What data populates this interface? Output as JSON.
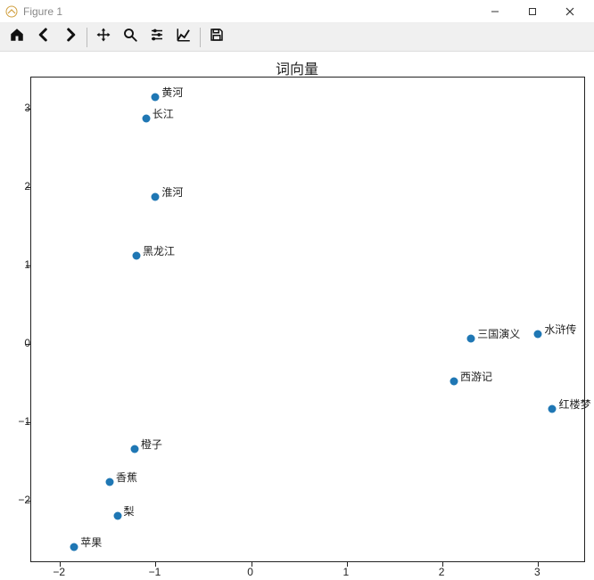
{
  "window": {
    "title": "Figure 1",
    "minimize_tooltip": "Minimize",
    "maximize_tooltip": "Maximize",
    "close_tooltip": "Close"
  },
  "toolbar": {
    "items": [
      {
        "name": "home-icon",
        "label": "Home"
      },
      {
        "name": "back-icon",
        "label": "Back"
      },
      {
        "name": "forward-icon",
        "label": "Forward"
      },
      {
        "sep": true
      },
      {
        "name": "move-icon",
        "label": "Pan"
      },
      {
        "name": "zoom-icon",
        "label": "Zoom"
      },
      {
        "name": "config-icon",
        "label": "Configure subplots"
      },
      {
        "name": "axes-icon",
        "label": "Edit axis"
      },
      {
        "sep": true
      },
      {
        "name": "save-icon",
        "label": "Save"
      }
    ]
  },
  "chart_data": {
    "type": "scatter",
    "title": "词向量",
    "xlabel": "",
    "ylabel": "",
    "xlim": [
      -2.3,
      3.5
    ],
    "ylim": [
      -2.8,
      3.4
    ],
    "xticks": [
      -2,
      -1,
      0,
      1,
      2,
      3
    ],
    "yticks": [
      -2,
      -1,
      0,
      1,
      2,
      3
    ],
    "points": [
      {
        "label": "黄河",
        "x": -1.0,
        "y": 3.15
      },
      {
        "label": "长江",
        "x": -1.1,
        "y": 2.88
      },
      {
        "label": "淮河",
        "x": -1.0,
        "y": 1.88
      },
      {
        "label": "黑龙江",
        "x": -1.2,
        "y": 1.12
      },
      {
        "label": "三国演义",
        "x": 2.3,
        "y": 0.07
      },
      {
        "label": "水浒传",
        "x": 3.0,
        "y": 0.12
      },
      {
        "label": "西游记",
        "x": 2.12,
        "y": -0.48
      },
      {
        "label": "红楼梦",
        "x": 3.15,
        "y": -0.83
      },
      {
        "label": "橙子",
        "x": -1.22,
        "y": -1.34
      },
      {
        "label": "香蕉",
        "x": -1.48,
        "y": -1.77
      },
      {
        "label": "梨",
        "x": -1.4,
        "y": -2.2
      },
      {
        "label": "苹果",
        "x": -1.85,
        "y": -2.6
      }
    ],
    "point_color": "#1f77b4"
  }
}
